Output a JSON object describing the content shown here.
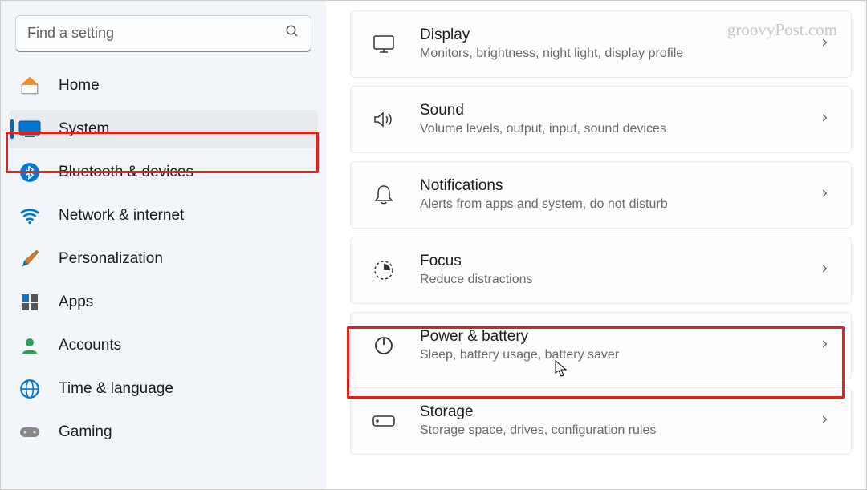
{
  "search": {
    "placeholder": "Find a setting"
  },
  "sidebar": {
    "items": [
      {
        "label": "Home"
      },
      {
        "label": "System"
      },
      {
        "label": "Bluetooth & devices"
      },
      {
        "label": "Network & internet"
      },
      {
        "label": "Personalization"
      },
      {
        "label": "Apps"
      },
      {
        "label": "Accounts"
      },
      {
        "label": "Time & language"
      },
      {
        "label": "Gaming"
      }
    ]
  },
  "main": {
    "cards": [
      {
        "title": "Display",
        "sub": "Monitors, brightness, night light, display profile"
      },
      {
        "title": "Sound",
        "sub": "Volume levels, output, input, sound devices"
      },
      {
        "title": "Notifications",
        "sub": "Alerts from apps and system, do not disturb"
      },
      {
        "title": "Focus",
        "sub": "Reduce distractions"
      },
      {
        "title": "Power & battery",
        "sub": "Sleep, battery usage, battery saver"
      },
      {
        "title": "Storage",
        "sub": "Storage space, drives, configuration rules"
      }
    ]
  },
  "watermark": "groovyPost.com"
}
